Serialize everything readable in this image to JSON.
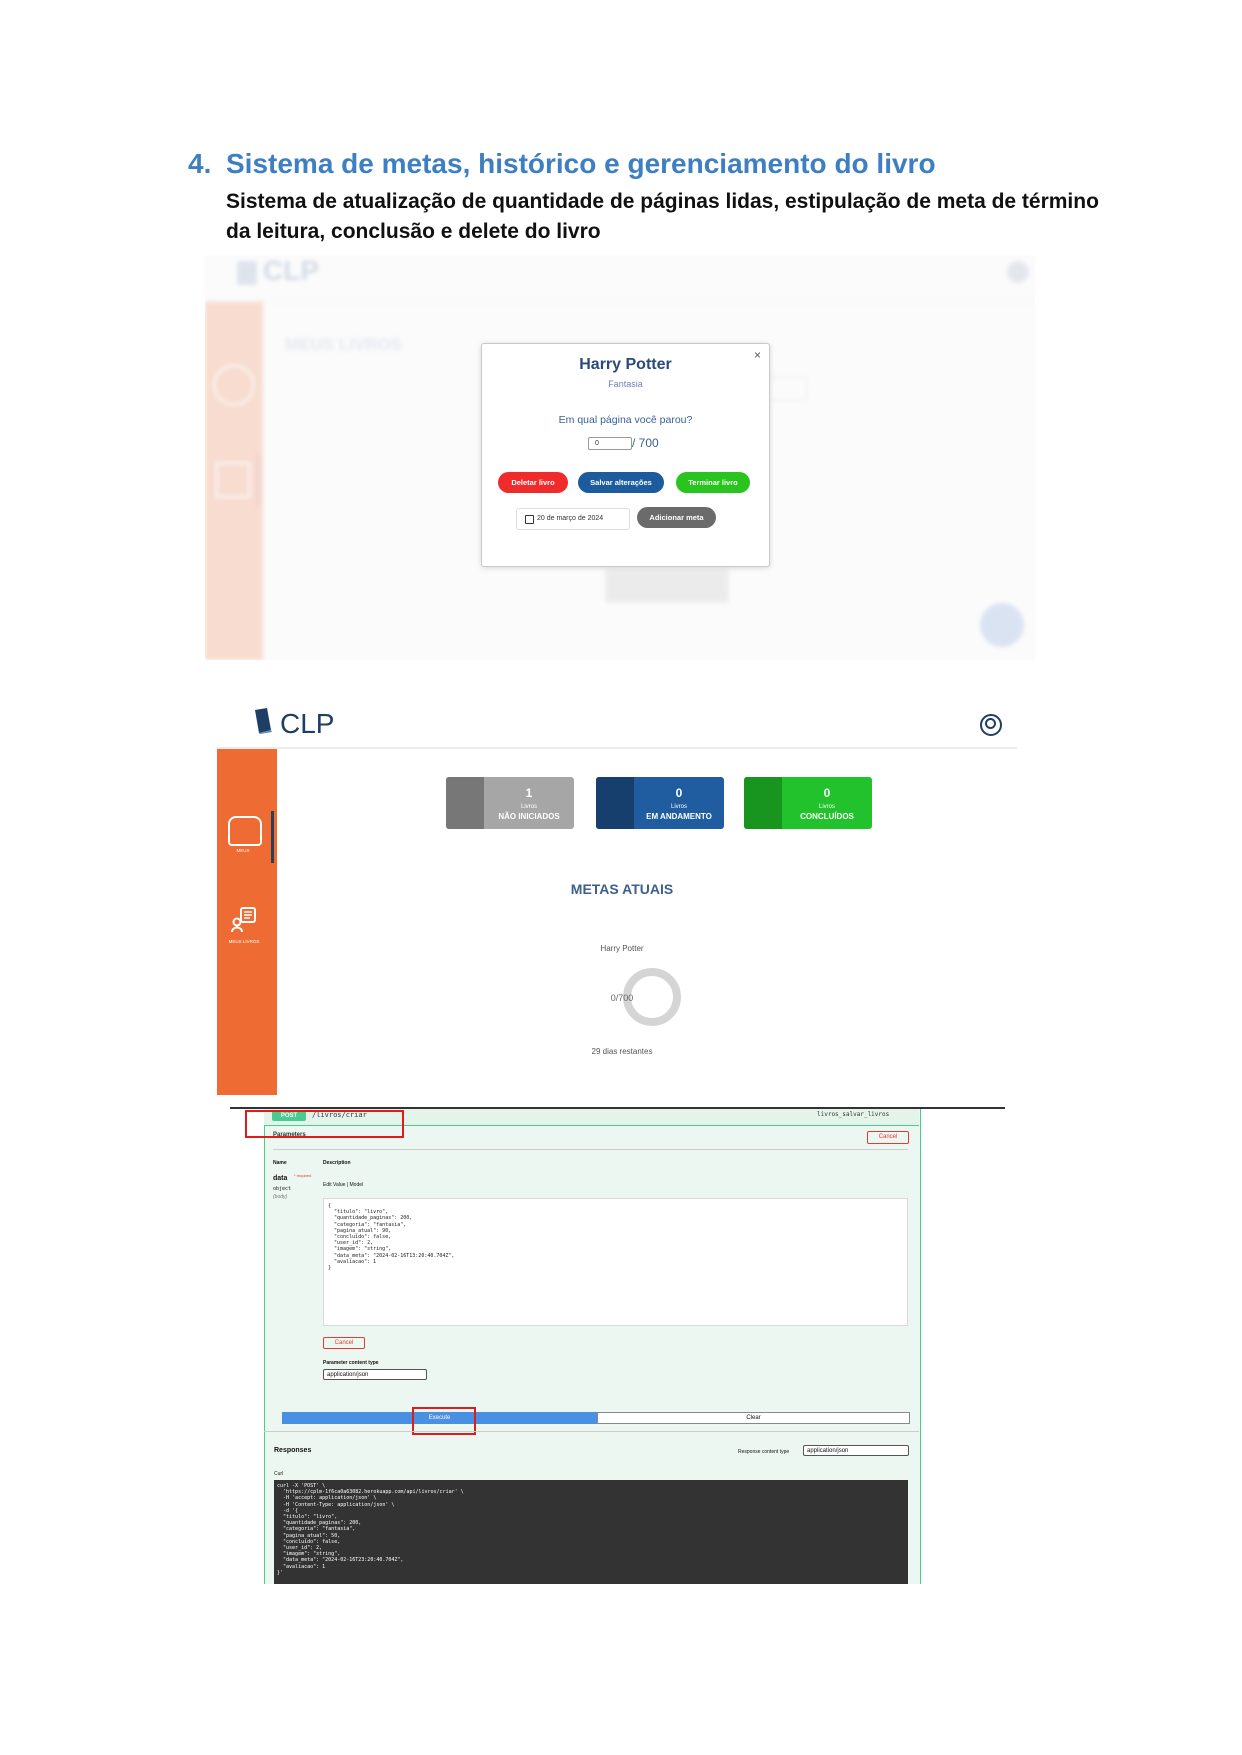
{
  "heading": {
    "number": "4.",
    "title": "Sistema de metas, histórico e gerenciamento do livro",
    "subtitle": "Sistema de atualização de quantidade de páginas lidas,  estipulação de meta de término da leitura, conclusão e delete do livro"
  },
  "modal": {
    "close": "×",
    "title": "Harry Potter",
    "genre": "Fantasia",
    "question": "Em qual página você parou?",
    "page_value": "0",
    "total": "/ 700",
    "delete_label": "Deletar livro",
    "save_label": "Salvar alterações",
    "finish_label": "Terminar livro",
    "date_value": "20 de março de 2024",
    "add_goal_label": "Adicionar meta"
  },
  "background_app": {
    "logo": "CLP",
    "section": "MEUS LIVROS"
  },
  "dashboard": {
    "logo": "CLP",
    "sidebar": {
      "home_label": "MEUS",
      "books_label": "MEUS LIVROS"
    },
    "cards": [
      {
        "count": "1",
        "line1": "Livros",
        "line2": "NÃO INICIADOS",
        "color": "#a6a6a6",
        "icon": "progress-icon"
      },
      {
        "count": "0",
        "line1": "Livros",
        "line2": "EM ANDAMENTO",
        "color": "#1f5ca0",
        "icon": "timer-icon"
      },
      {
        "count": "0",
        "line1": "Livros",
        "line2": "CONCLUÍDOS",
        "color": "#21c22b",
        "icon": "checklist-icon"
      }
    ],
    "goals_title": "METAS ATUAIS",
    "goal": {
      "book": "Harry Potter",
      "progress": "0/700",
      "progress_fraction": 0,
      "days_left": "29 dias restantes"
    }
  },
  "swagger": {
    "method": "POST",
    "path": "/livros/criar",
    "operation": "livros_salvar_livros",
    "parameters_label": "Parameters",
    "cancel_label": "Cancel",
    "col_name": "Name",
    "col_description": "Description",
    "param_name": "data",
    "required_label": "* required",
    "param_type": "object",
    "param_in": "(body)",
    "edit_value_label": "Edit Value | Model",
    "body_json": "{\n  \"titulo\": \"livro\",\n  \"quantidade_paginas\": 200,\n  \"categoria\": \"fantasia\",\n  \"pagina_atual\": 90,\n  \"concluido\": false,\n  \"user_id\": 2,\n  \"imagem\": \"string\",\n  \"data_meta\": \"2024-02-16T13:20:40.704Z\",\n  \"avaliacao\": 1\n}",
    "cancel2_label": "Cancel",
    "param_content_type_label": "Parameter content type",
    "param_content_type": "application/json",
    "execute_label": "Execute",
    "clear_label": "Clear",
    "responses_label": "Responses",
    "response_content_type_label": "Response content type",
    "response_content_type": "application/json",
    "curl_label": "Curl",
    "curl": "curl -X 'POST' \\\n  'https://cplm-1f6ca0a63082.herokuapp.com/api/livros/criar' \\\n  -H 'accept: application/json' \\\n  -H 'Content-Type: application/json' \\\n  -d '{\n  \"titulo\": \"livro\",\n  \"quantidade_paginas\": 200,\n  \"categoria\": \"fantasia\",\n  \"pagina_atual\": 50,\n  \"concluido\": false,\n  \"user_id\": 2,\n  \"imagem\": \"string\",\n  \"data_meta\": \"2024-02-16T23:20:40.704Z\",\n  \"avaliacao\": 1\n}'"
  }
}
